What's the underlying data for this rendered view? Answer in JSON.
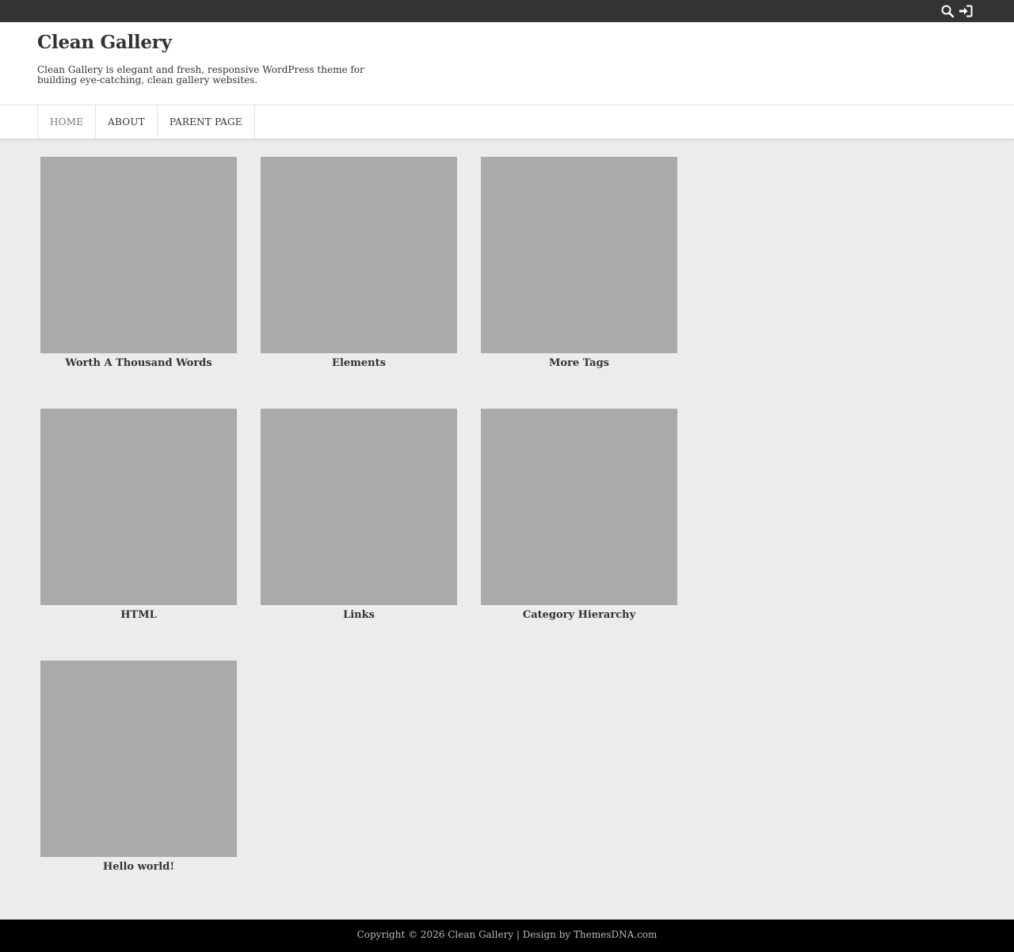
{
  "topbar": {
    "search_icon": "search-icon",
    "login_icon": "sign-in-icon"
  },
  "site": {
    "title": "Clean Gallery",
    "tagline": "Clean Gallery is elegant and fresh, responsive WordPress theme for building eye-catching, clean gallery websites."
  },
  "nav": {
    "items": [
      {
        "label": "HOME"
      },
      {
        "label": "ABOUT"
      },
      {
        "label": "PARENT PAGE"
      }
    ]
  },
  "posts": [
    {
      "title": "Worth A Thousand Words"
    },
    {
      "title": "Elements"
    },
    {
      "title": "More Tags"
    },
    {
      "title": "HTML"
    },
    {
      "title": "Links"
    },
    {
      "title": "Category Hierarchy"
    },
    {
      "title": "Hello world!"
    }
  ],
  "footer": {
    "copyright": "Copyright © 2026 Clean Gallery",
    "separator": " | ",
    "design_by": "Design by ThemesDNA.com"
  },
  "colors": {
    "topbar": "#333333",
    "page_bg": "#ececec",
    "thumbnail_placeholder": "#aaaaaa",
    "footer_bg": "#000000"
  }
}
